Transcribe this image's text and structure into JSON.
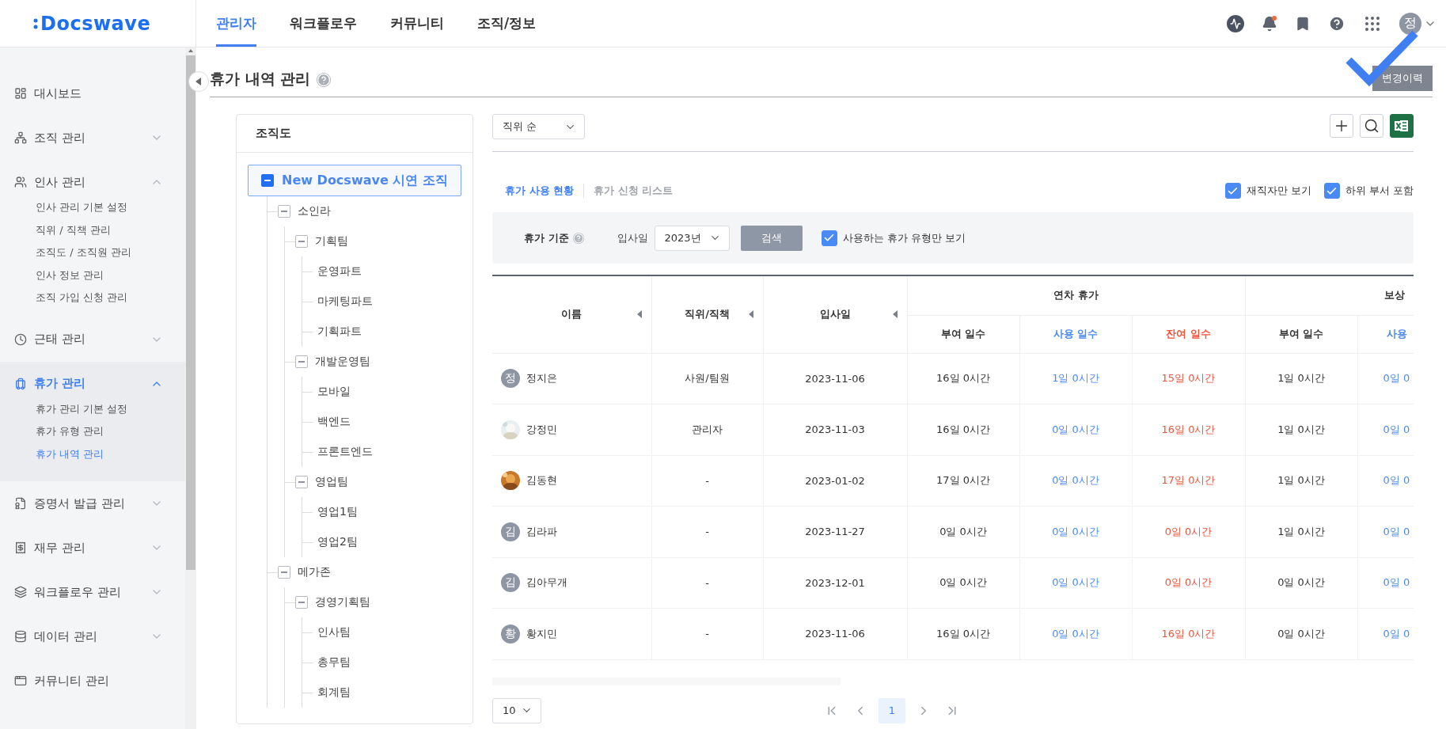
{
  "header": {
    "logo": "Docswave",
    "nav": [
      {
        "label": "관리자",
        "selected": true
      },
      {
        "label": "워크플로우",
        "selected": false
      },
      {
        "label": "커뮤니티",
        "selected": false
      },
      {
        "label": "조직/정보",
        "selected": false
      }
    ],
    "avatar": "정"
  },
  "sidebar": {
    "items": [
      {
        "label": "대시보드",
        "selected": false
      },
      {
        "label": "조직 관리",
        "selected": false,
        "expanded": false
      },
      {
        "label": "인사 관리",
        "selected": false,
        "expanded": true,
        "children": [
          {
            "label": "인사 관리 기본 설정",
            "selected": false
          },
          {
            "label": "직위 / 직책 관리",
            "selected": false
          },
          {
            "label": "조직도 / 조직원 관리",
            "selected": false
          },
          {
            "label": "인사 정보 관리",
            "selected": false
          },
          {
            "label": "조직 가입 신청 관리",
            "selected": false
          }
        ]
      },
      {
        "label": "근태 관리",
        "selected": false,
        "expanded": false
      },
      {
        "label": "휴가 관리",
        "selected": true,
        "expanded": true,
        "children": [
          {
            "label": "휴가 관리 기본 설정",
            "selected": false
          },
          {
            "label": "휴가 유형 관리",
            "selected": false
          },
          {
            "label": "휴가 내역 관리",
            "selected": true
          }
        ]
      },
      {
        "label": "증명서 발급 관리",
        "selected": false,
        "expanded": false
      },
      {
        "label": "재무 관리",
        "selected": false,
        "expanded": false
      },
      {
        "label": "워크플로우 관리",
        "selected": false,
        "expanded": false
      },
      {
        "label": "데이터 관리",
        "selected": false,
        "expanded": false
      },
      {
        "label": "커뮤니티 관리",
        "selected": false
      }
    ]
  },
  "page": {
    "title": "휴가 내역 관리",
    "history_button": "변경이력"
  },
  "org_panel": {
    "title": "조직도",
    "tree": [
      {
        "label": "New Docswave 시연 조직",
        "selected": true,
        "expanded": true,
        "children": [
          {
            "label": "소인라",
            "selected": false,
            "expanded": true,
            "children": [
              {
                "label": "기획팀",
                "selected": false,
                "expanded": true,
                "children": [
                  {
                    "label": "운영파트",
                    "selected": false
                  },
                  {
                    "label": "마케팅파트",
                    "selected": false
                  },
                  {
                    "label": "기획파트",
                    "selected": false
                  }
                ]
              },
              {
                "label": "개발운영팀",
                "selected": false,
                "expanded": true,
                "children": [
                  {
                    "label": "모바일",
                    "selected": false
                  },
                  {
                    "label": "백엔드",
                    "selected": false
                  },
                  {
                    "label": "프론트엔드",
                    "selected": false
                  }
                ]
              },
              {
                "label": "영업팀",
                "selected": false,
                "expanded": true,
                "children": [
                  {
                    "label": "영업1팀",
                    "selected": false
                  },
                  {
                    "label": "영업2팀",
                    "selected": false
                  }
                ]
              }
            ]
          },
          {
            "label": "메가존",
            "selected": false,
            "expanded": true,
            "children": [
              {
                "label": "경영기획팀",
                "selected": false,
                "expanded": true,
                "children": [
                  {
                    "label": "인사팀",
                    "selected": false
                  },
                  {
                    "label": "총무팀",
                    "selected": false
                  },
                  {
                    "label": "회계팀",
                    "selected": false
                  }
                ]
              }
            ]
          }
        ]
      }
    ]
  },
  "toolbar": {
    "sort_select": "직위 순"
  },
  "view_tabs": [
    {
      "label": "휴가 사용 현황",
      "selected": true
    },
    {
      "label": "휴가 신청 리스트",
      "selected": false
    }
  ],
  "filters": [
    {
      "label": "재직자만 보기",
      "checked": true
    },
    {
      "label": "하위 부서 포함",
      "checked": true
    }
  ],
  "search_bar": {
    "label": "휴가 기준",
    "date_label": "입사일",
    "year_select": "2023년",
    "search_button": "검색",
    "only_used_types": {
      "label": "사용하는 휴가 유형만 보기",
      "checked": true
    }
  },
  "table": {
    "columns": [
      {
        "label": "이름"
      },
      {
        "label": "직위/직책"
      },
      {
        "label": "입사일"
      }
    ],
    "groups": [
      {
        "label": "연차 휴가",
        "columns": [
          {
            "label": "부여 일수",
            "kind": "plain"
          },
          {
            "label": "사용 일수",
            "kind": "used"
          },
          {
            "label": "잔여 일수",
            "kind": "remaining"
          }
        ]
      },
      {
        "label": "보상",
        "columns": [
          {
            "label": "부여 일수",
            "kind": "plain"
          },
          {
            "label": "사용",
            "kind": "used"
          }
        ]
      }
    ],
    "rows": [
      {
        "avatar": {
          "kind": "initial",
          "text": "정"
        },
        "name": "정지은",
        "position": "사원/팀원",
        "join_date": "2023-11-06",
        "values": [
          "16일 0시간",
          "1일 0시간",
          "15일 0시간",
          "1일 0시간",
          "0일 0"
        ]
      },
      {
        "avatar": {
          "kind": "picture"
        },
        "name": "강정민",
        "position": "관리자",
        "join_date": "2023-11-03",
        "values": [
          "16일 0시간",
          "0일 0시간",
          "16일 0시간",
          "1일 0시간",
          "0일 0"
        ]
      },
      {
        "avatar": {
          "kind": "picture"
        },
        "name": "김동현",
        "position": "-",
        "join_date": "2023-01-02",
        "values": [
          "17일 0시간",
          "0일 0시간",
          "17일 0시간",
          "1일 0시간",
          "0일 0"
        ]
      },
      {
        "avatar": {
          "kind": "initial",
          "text": "김"
        },
        "name": "김라파",
        "position": "-",
        "join_date": "2023-11-27",
        "values": [
          "0일 0시간",
          "0일 0시간",
          "0일 0시간",
          "1일 0시간",
          "0일 0"
        ]
      },
      {
        "avatar": {
          "kind": "initial",
          "text": "김"
        },
        "name": "김아무개",
        "position": "-",
        "join_date": "2023-12-01",
        "values": [
          "0일 0시간",
          "0일 0시간",
          "0일 0시간",
          "0일 0시간",
          "0일 0"
        ]
      },
      {
        "avatar": {
          "kind": "initial",
          "text": "황"
        },
        "name": "황지민",
        "position": "-",
        "join_date": "2023-11-06",
        "values": [
          "16일 0시간",
          "0일 0시간",
          "16일 0시간",
          "0일 0시간",
          "0일 0"
        ]
      }
    ]
  },
  "pagination": {
    "page_size": "10",
    "pages": [
      {
        "label": "1",
        "selected": true
      }
    ]
  }
}
